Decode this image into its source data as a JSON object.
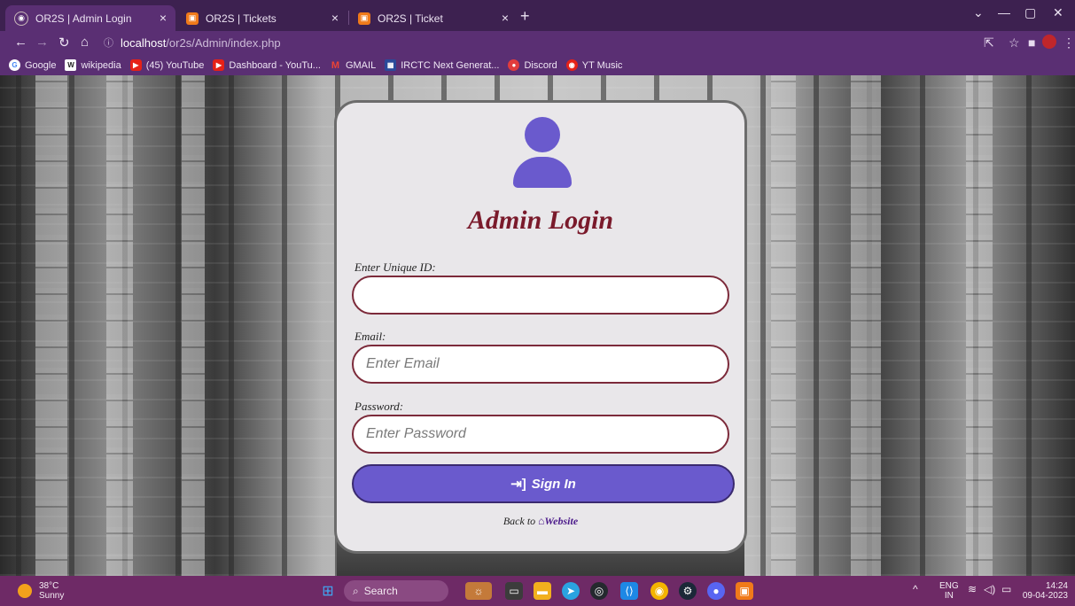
{
  "browser": {
    "tabs": [
      {
        "title": "OR2S | Admin Login",
        "active": true
      },
      {
        "title": "OR2S | Tickets",
        "active": false
      },
      {
        "title": "OR2S | Ticket",
        "active": false
      }
    ],
    "url_host": "localhost",
    "url_path": "/or2s/Admin/index.php",
    "bookmarks": [
      {
        "label": "Google",
        "icon": "google-icon"
      },
      {
        "label": "wikipedia",
        "icon": "wikipedia-icon"
      },
      {
        "label": "(45) YouTube",
        "icon": "youtube-icon"
      },
      {
        "label": "Dashboard - YouTu...",
        "icon": "youtube-studio-icon"
      },
      {
        "label": "GMAIL",
        "icon": "gmail-icon"
      },
      {
        "label": "IRCTC Next Generat...",
        "icon": "irctc-icon"
      },
      {
        "label": "Discord",
        "icon": "discord-icon"
      },
      {
        "label": "YT Music",
        "icon": "yt-music-icon"
      }
    ]
  },
  "login": {
    "title": "Admin Login",
    "unique_id_label": "Enter Unique ID:",
    "unique_id_value": "",
    "email_label": "Email:",
    "email_placeholder": "Enter Email",
    "password_label": "Password:",
    "password_placeholder": "Enter Password",
    "sign_in_label": "Sign In",
    "back_text": "Back to",
    "back_link": "Website"
  },
  "taskbar": {
    "temperature": "38°C",
    "condition": "Sunny",
    "search_placeholder": "Search",
    "language": "ENG",
    "region": "IN",
    "time": "14:24",
    "date": "09-04-2023"
  },
  "colors": {
    "accent": "#6a5acd",
    "title": "#7a1a2b",
    "input_border": "#7c2a3a",
    "chrome": "#5a2f73",
    "taskbar": "#6e2a66"
  }
}
